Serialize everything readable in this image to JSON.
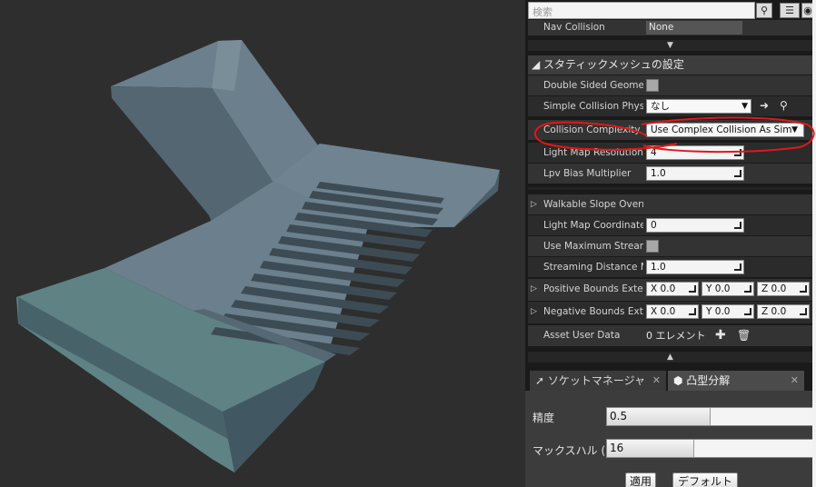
{
  "search": {
    "placeholder": "検索"
  },
  "panel": {
    "nav_collision_label": "Nav Collision",
    "nav_collision_value": "None",
    "section_title": "スタティックメッシュの設定",
    "rows": {
      "double_sided": "Double Sided Geomet",
      "simple_collision": "Simple Collision Phys",
      "simple_collision_value": "なし",
      "collision_complexity": "Collision Complexity",
      "collision_complexity_value": "Use Complex Collision As Sim",
      "light_map_resolution": "Light Map Resolution",
      "light_map_resolution_value": "4",
      "lpv_bias": "Lpv Bias Multiplier",
      "lpv_bias_value": "1.0",
      "walkable_slope": "Walkable Slope Overr",
      "light_map_coord": "Light Map Coordinate",
      "light_map_coord_value": "0",
      "use_max_streaming": "Use Maximum Strear",
      "streaming_distance": "Streaming Distance M",
      "streaming_distance_value": "1.0",
      "positive_bounds": "Positive Bounds Exte",
      "negative_bounds": "Negative Bounds Exte",
      "x_label": "X",
      "y_label": "Y",
      "z_label": "Z",
      "pos_x": "0.0",
      "pos_y": "0.0",
      "pos_z": "0.0",
      "neg_x": "0.0",
      "neg_y": "0.0",
      "neg_z": "0.0",
      "asset_user_data": "Asset User Data",
      "asset_user_data_value": "0 エレメント"
    }
  },
  "tabs": {
    "socket_manager": "ソケットマネージャ",
    "convex_decomp": "凸型分解"
  },
  "convex": {
    "accuracy_label": "精度",
    "accuracy_value": "0.5",
    "accuracy_fill": 0.5,
    "max_hull_label": "マックスハル (",
    "max_hull_value": "16",
    "max_hull_fill": 0.42,
    "apply": "適用",
    "default": "デフォルト"
  },
  "colors": {
    "mesh_body": "#6a7f8b",
    "annotation": "#e01818"
  },
  "icons": [
    "search-icon",
    "grid-view-icon",
    "eye-icon",
    "arrow-left-icon",
    "browse-icon",
    "plus-icon",
    "trash-icon",
    "socket-wrench-icon",
    "convex-icon",
    "close-icon",
    "expand-down-icon",
    "collapse-up-icon"
  ]
}
